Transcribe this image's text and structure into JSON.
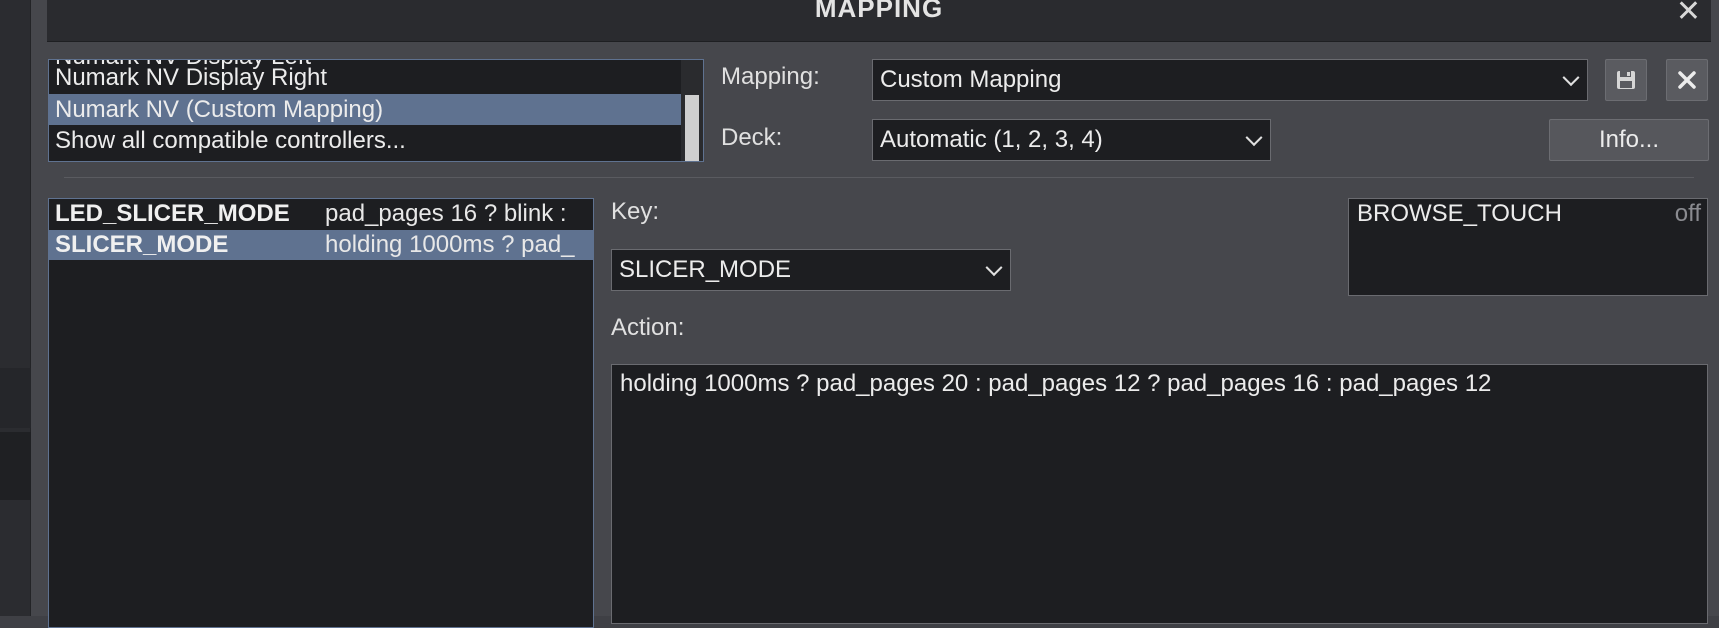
{
  "dialog": {
    "title": "MAPPING",
    "close_glyph": "✕"
  },
  "controllers": [
    "Numark NV Display Left",
    "Numark NV Display Right",
    "Numark NV (Custom Mapping)",
    "Show all compatible controllers..."
  ],
  "mapping": {
    "label": "Mapping:",
    "value": "Custom Mapping",
    "save_icon": "save-icon",
    "delete_icon": "close-icon"
  },
  "deck": {
    "label": "Deck:",
    "value": "Automatic (1, 2, 3, 4)",
    "info_label": "Info..."
  },
  "keys": [
    {
      "key": "LED_SLICER_MODE",
      "action": "pad_pages 16 ? blink : "
    },
    {
      "key": "SLICER_MODE",
      "action": "holding 1000ms ? pad_"
    }
  ],
  "key_field": {
    "label": "Key:",
    "value": "SLICER_MODE"
  },
  "action_field": {
    "label": "Action:",
    "value": "holding 1000ms ? pad_pages 20 : pad_pages 12 ? pad_pages 16 : pad_pages 12"
  },
  "browse_status": {
    "name": "BROWSE_TOUCH",
    "state": "off"
  },
  "colors": {
    "selection": "#5f7290",
    "panel": "#1d1e21",
    "background": "#46474c"
  }
}
